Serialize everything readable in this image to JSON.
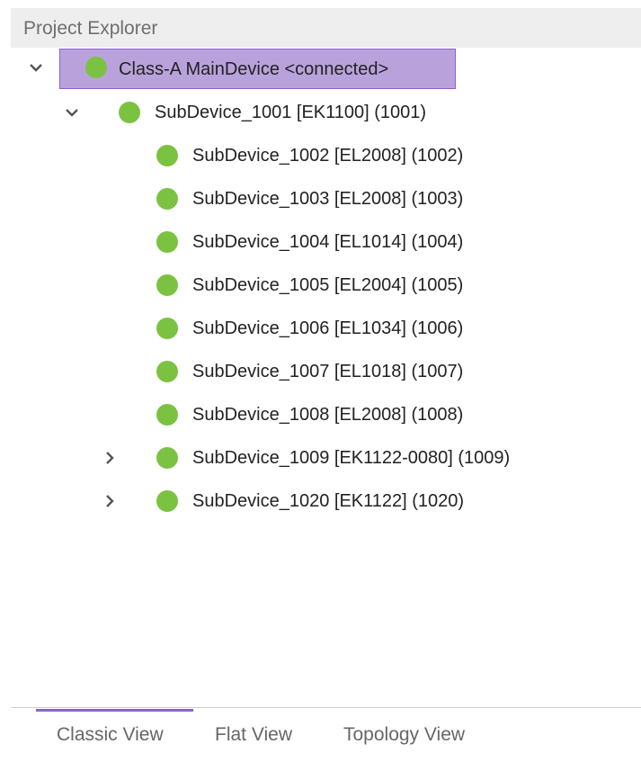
{
  "panel": {
    "title": "Project Explorer"
  },
  "colors": {
    "status_connected": "#7cc242",
    "selection_fill": "#b9a2dc",
    "selection_border": "#8b63c8",
    "active_tab_indicator": "#8b63c8"
  },
  "tree": {
    "root": {
      "label": "Class-A MainDevice <connected>",
      "expanded": true,
      "selected": true,
      "status": "connected"
    },
    "subdevice_1001": {
      "label": "SubDevice_1001 [EK1100] (1001)",
      "expanded": true,
      "status": "connected"
    },
    "children": [
      {
        "label": "SubDevice_1002 [EL2008] (1002)",
        "status": "connected"
      },
      {
        "label": "SubDevice_1003 [EL2008] (1003)",
        "status": "connected"
      },
      {
        "label": "SubDevice_1004 [EL1014] (1004)",
        "status": "connected"
      },
      {
        "label": "SubDevice_1005 [EL2004] (1005)",
        "status": "connected"
      },
      {
        "label": "SubDevice_1006 [EL1034] (1006)",
        "status": "connected"
      },
      {
        "label": "SubDevice_1007 [EL1018] (1007)",
        "status": "connected"
      },
      {
        "label": "SubDevice_1008 [EL2008] (1008)",
        "status": "connected"
      },
      {
        "label": "SubDevice_1009 [EK1122-0080] (1009)",
        "status": "connected",
        "expanded": false
      },
      {
        "label": "SubDevice_1020 [EK1122] (1020)",
        "status": "connected",
        "expanded": false
      }
    ]
  },
  "tabs": [
    {
      "label": "Classic View",
      "active": true
    },
    {
      "label": "Flat View",
      "active": false
    },
    {
      "label": "Topology View",
      "active": false
    }
  ]
}
